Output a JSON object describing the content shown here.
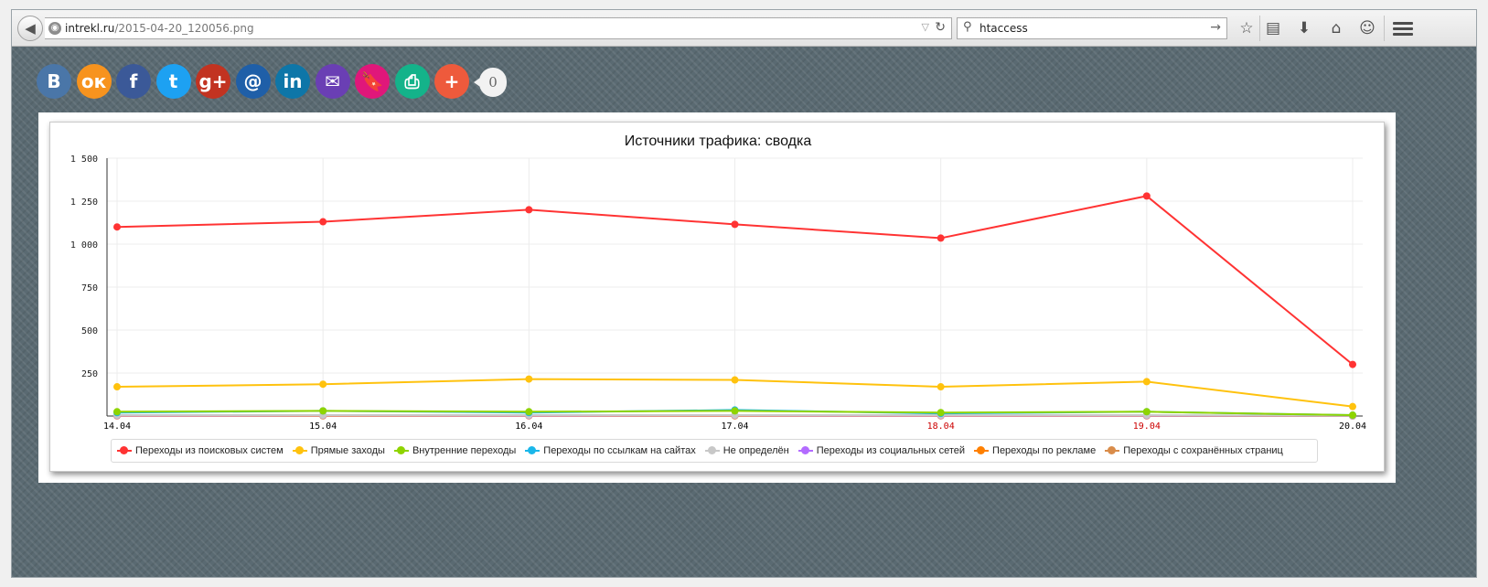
{
  "browser": {
    "url_domain": "intrekl.ru",
    "url_path": "/2015-04-20_120056.png",
    "search_value": "htaccess"
  },
  "share": {
    "buttons": [
      {
        "name": "vk",
        "glyph": "В",
        "color": "#4a76a8"
      },
      {
        "name": "odnoklassniki",
        "glyph": "ок",
        "color": "#f7931e"
      },
      {
        "name": "facebook",
        "glyph": "f",
        "color": "#3b5998"
      },
      {
        "name": "twitter",
        "glyph": "t",
        "color": "#1da1f2"
      },
      {
        "name": "google-plus",
        "glyph": "g+",
        "color": "#c23321"
      },
      {
        "name": "mail-ru",
        "glyph": "@",
        "color": "#1f5fa8"
      },
      {
        "name": "linkedin",
        "glyph": "in",
        "color": "#0e76a8"
      },
      {
        "name": "email",
        "glyph": "✉",
        "color": "#6a3fb4"
      },
      {
        "name": "bookmark",
        "glyph": "🔖",
        "color": "#e0177a"
      },
      {
        "name": "print",
        "glyph": "⎙",
        "color": "#14b38a"
      },
      {
        "name": "more",
        "glyph": "+",
        "color": "#ee5a3c"
      }
    ],
    "count": "0"
  },
  "chart_data": {
    "type": "line",
    "title": "Источники трафика: сводка",
    "categories": [
      "14.04",
      "15.04",
      "16.04",
      "17.04",
      "18.04",
      "19.04",
      "20.04"
    ],
    "category_colors": [
      "#000000",
      "#000000",
      "#000000",
      "#000000",
      "#cc0000",
      "#cc0000",
      "#000000"
    ],
    "ylim": [
      0,
      1500
    ],
    "yticks": [
      250,
      500,
      750,
      1000,
      1250,
      1500
    ],
    "ytick_labels": [
      "250",
      "500",
      "750",
      "1 000",
      "1 250",
      "1 500"
    ],
    "grid": true,
    "legend_position": "bottom",
    "series": [
      {
        "name": "Переходы из поисковых систем",
        "color": "#ff3333",
        "values": [
          1100,
          1130,
          1200,
          1115,
          1035,
          1280,
          300
        ]
      },
      {
        "name": "Прямые заходы",
        "color": "#ffc20e",
        "values": [
          170,
          185,
          215,
          210,
          170,
          200,
          55
        ]
      },
      {
        "name": "Внутренние переходы",
        "color": "#8fd400",
        "values": [
          25,
          30,
          25,
          30,
          20,
          25,
          5
        ]
      },
      {
        "name": "Переходы по ссылкам на сайтах",
        "color": "#1ab7ea",
        "values": [
          20,
          30,
          20,
          35,
          15,
          25,
          5
        ]
      },
      {
        "name": "Не определён",
        "color": "#c8c8c8",
        "values": [
          5,
          5,
          5,
          5,
          5,
          5,
          2
        ]
      },
      {
        "name": "Переходы из социальных сетей",
        "color": "#b36bff",
        "values": [
          3,
          4,
          3,
          4,
          3,
          3,
          1
        ]
      },
      {
        "name": "Переходы по рекламе",
        "color": "#ff8000",
        "values": [
          2,
          2,
          2,
          2,
          2,
          2,
          1
        ]
      },
      {
        "name": "Переходы с сохранённых страниц",
        "color": "#d98c4a",
        "values": [
          1,
          1,
          1,
          1,
          1,
          1,
          0
        ]
      }
    ]
  }
}
